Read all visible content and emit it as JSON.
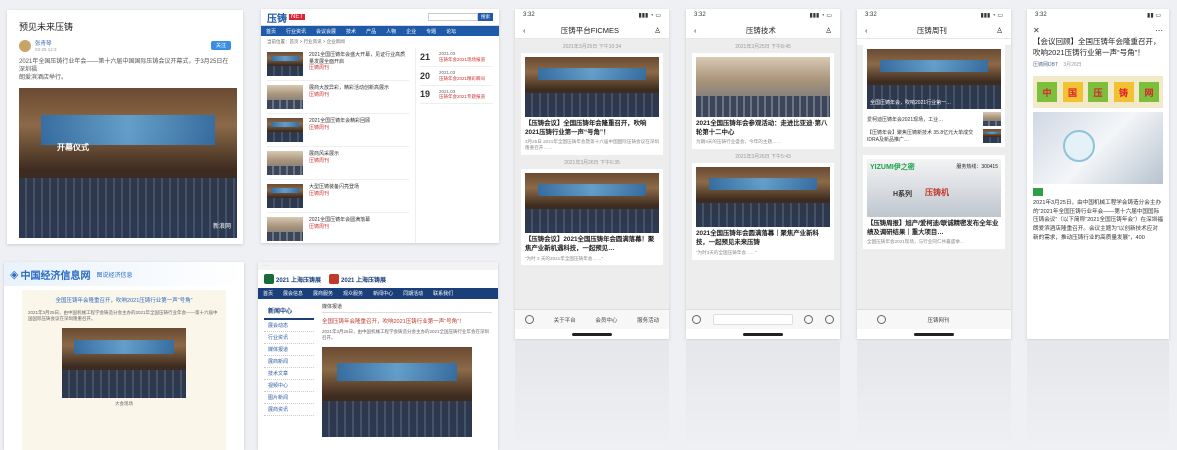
{
  "card1": {
    "title": "预见未来压铸",
    "author": "张青琴",
    "date": "03-25 12:3",
    "follow": "关注",
    "body": "2021年全国压铸行业年会——第十六届中国国际压铸会议开幕式，于3月25日在深圳福",
    "body2": "朗爱滨酒店举行。",
    "banner": "开幕仪式",
    "watermark": "新浪网"
  },
  "card2": {
    "logo": "压铸",
    "search_btn": "搜索",
    "nav": [
      "首页",
      "行业资讯",
      "会议会展",
      "技术",
      "产品",
      "人物",
      "企业",
      "专题",
      "论坛"
    ],
    "breadcrumb": "当前位置：首页 > 行业资讯 > 企业新闻",
    "items": [
      {
        "title": "2021全国压铸年会盛大开幕，见证行业高质量发展全面开启",
        "meta": "压铸周刊"
      },
      {
        "title": "展商大放异彩，精彩活动创新高展示",
        "meta": "压铸周刊"
      },
      {
        "title": "2021全国压铸年会精彩回顾",
        "meta": "压铸周刊"
      },
      {
        "title": "展商风采展示",
        "meta": "压铸周刊"
      },
      {
        "title": "大型压铸装备闪亮登场",
        "meta": "压铸周刊"
      },
      {
        "title": "2021全国压铸年会圆满落幕",
        "meta": "压铸周刊"
      }
    ],
    "side_dates": [
      "21",
      "20",
      "19"
    ],
    "side_month": "2021.03",
    "side_links": [
      "压铸年会2021现场报道",
      "压铸年会2021精彩瞬间",
      "压铸年会2021专题报道"
    ]
  },
  "phone1": {
    "time": "3:32",
    "title": "压铸平台FICMES",
    "ts1": "2021年3月25日 下午10:34",
    "card1_title": "【压铸会议】全国压铸年会隆重召开，吹响2021压铸行业第一声“号角”！",
    "card1_sub": "3月25日 2021年全国压铸年会暨第十六届中国国际压铸会议在深圳隆重召开……",
    "ts2": "2021年3月26日 下午6:35",
    "card2_title": "【压铸会议】2021全国压铸年会圆满落幕！聚焦产业新机遇科技，一起预见…",
    "card2_sub": "“为时 3 天的2021年全国压铸年会……”",
    "menu": [
      "关于平台",
      "会员中心",
      "服务活动"
    ]
  },
  "phone2": {
    "time": "3:32",
    "title": "压铸技术",
    "ts1": "2021年3月25日 下午8:45",
    "card1_title": "2021全国压铸年会参观活动：走进比亚迪·第八轮第十二中心",
    "card1_sub": "为期3天的压铸行业盛会，今年的主题……",
    "ts2": "2021年3月26日 下午5:43",
    "card2_title": "2021全国压铸年会圆满落幕｜聚焦产业新科技，一起预见未来压铸",
    "card2_sub": "“为时3天的全国压铸年会……”"
  },
  "phone3": {
    "time": "3:32",
    "title": "压铸周刊",
    "banner_text": "全国压铸年会，吹响2021行业第一…",
    "items": [
      "爱柯迪压铸年会2021现场，工业…",
      "【压铸年会】聚焦压铸新技术 35.8亿元大单成交 IDRA及新品推广…"
    ],
    "ad_brand": "YIZUMI伊之密",
    "ad_phone": "服务热线：300415",
    "ad_series": "H系列",
    "ad_word": "压铸机",
    "card_title": "【压铸周报】旭产/爱柯迪/联诚精密发布全年业绩及调研结果｜重大项目…",
    "card_sub": "全国压铸年会2021现场，与行业同仁共襄盛举…",
    "menu": "压铸网刊"
  },
  "card4": {
    "title": "【会议回顾】全国压铸年会隆重召开，吹响2021压铸行业第一声“号角”！",
    "account": "压铸网DBT",
    "date": "3月26日",
    "logo_chars": [
      "中",
      "国",
      "压",
      "铸",
      "网"
    ],
    "body": "2021年3月25日，由中国机械工程学会铸造分会主办的“2021年全国压铸行业年会——第十六届中国国际压铸会议”（以下简称“2021全国压铸年会”）在深圳福朗爱滨酒店隆重召开。会议主题为“以创新技术应对新的需求，推动压铸行业的高质量发展”，400"
  },
  "card5": {
    "logo": "中国经济信息网",
    "sub_logo": "图说经济信息",
    "headline": "全国压铸年会隆重召开，吹响2021压铸行业第一声“号角”",
    "caption": "大会现场",
    "para": "2021年3月25日，由中国机械工程学会铸造分会主办的2021年全国压铸行业年会——第十六届中国国际压铸会议在深圳隆重召开。"
  },
  "card6": {
    "logo_a": "2021 上海压铸展",
    "logo_b": "2021 上海压铸展",
    "nav": [
      "首页",
      "展会信息",
      "展商服务",
      "观众服务",
      "新闻中心",
      "同期活动",
      "联系我们"
    ],
    "side_title": "新闻中心",
    "side_items": [
      "展会动态",
      "行业资讯",
      "媒体报道",
      "展商新闻",
      "技术文章",
      "视频中心",
      "图片新闻",
      "展商资讯"
    ],
    "article_title": "全国压铸年会隆重召开，吹响2021压铸行业第一声“号角”！",
    "crumb": "媒体报道",
    "para": "2021年3月25日，由中国机械工程学会铸造分会主办的2021全国压铸行业年会在深圳召开。"
  }
}
